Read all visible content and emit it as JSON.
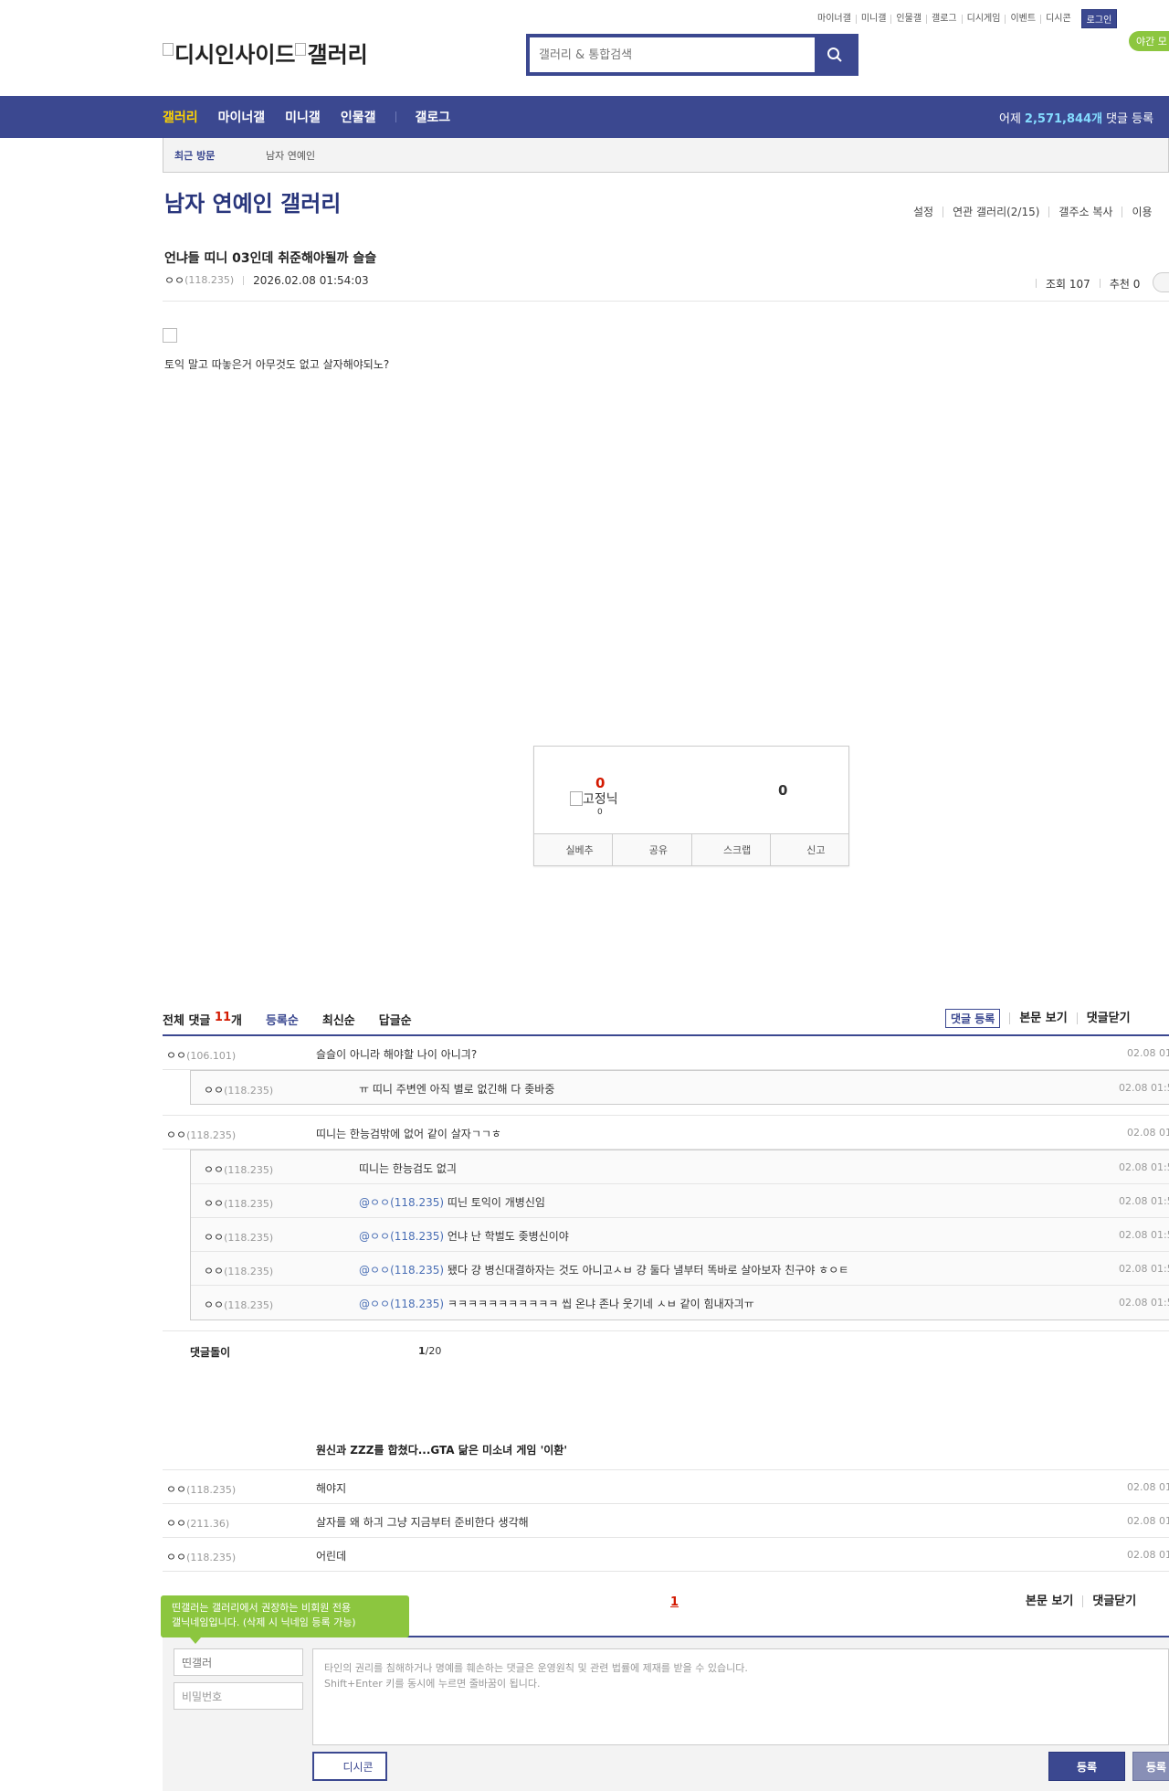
{
  "topmenu": [
    "마이너갤",
    "미니갤",
    "인물갤",
    "갤로그",
    "디시게임",
    "이벤트",
    "디시콘"
  ],
  "login_label": "로그인",
  "night_label": "야간 모",
  "logo": {
    "part1": "디시인사이드",
    "part2": "갤러리"
  },
  "search": {
    "placeholder": "갤러리 & 통합검색"
  },
  "nav": {
    "items": [
      "갤러리",
      "마이너갤",
      "미니갤",
      "인물갤"
    ],
    "gallog": "갤로그",
    "yesterday_prefix": "어제",
    "yesterday_count": "2,571,844개",
    "yesterday_suffix": "댓글 등록"
  },
  "recent": {
    "label": "최근 방문",
    "gallery": "남자 연예인"
  },
  "gallery": {
    "title": "남자 연예인 갤러리",
    "links": [
      "설정",
      "연관 갤러리(2/15)",
      "갤주소 복사",
      "이용"
    ]
  },
  "post": {
    "title": "언냐들 띠니 03인데 취준해야될까 슬슬",
    "author": "ㅇㅇ",
    "ip": "(118.235)",
    "date": "2026.02.08 01:54:03",
    "views_label": "조회 107",
    "recommend_label": "추천 0",
    "body": "토익 말고 따놓은거 아무것도 없고 살자해야되노?"
  },
  "recommend": {
    "up": "0",
    "fixnick_label": "고정닉",
    "fixnick_count": "0",
    "down": "0",
    "buttons": [
      "실베추",
      "공유",
      "스크랩",
      "신고"
    ]
  },
  "comments_header": {
    "total_label": "전체 댓글",
    "total_count": "11",
    "total_unit": "개",
    "sorts": [
      "등록순",
      "최신순",
      "답글순"
    ],
    "register": "댓글 등록",
    "view_body": "본문 보기",
    "close": "댓글닫기"
  },
  "comments": [
    {
      "nick": "ㅇㅇ",
      "ip": "(106.101)",
      "text": "슬슬이 아니라 해야할 나이 아니긔?",
      "date": "02.08 01"
    },
    {
      "nick": "ㅇㅇ",
      "ip": "(118.235)",
      "text": "띠니는 한능검밖에 없어 같이 살자ㄱㄱㅎ",
      "date": "02.08 01"
    }
  ],
  "replies_1": [
    {
      "nick": "ㅇㅇ",
      "ip": "(118.235)",
      "at": "",
      "text": "ㅠ 띠니 주변엔 아직 별로 없긴해 다 좆바중",
      "date": "02.08 01:5"
    }
  ],
  "replies_2": [
    {
      "nick": "ㅇㅇ",
      "ip": "(118.235)",
      "at": "",
      "text": "띠니는 한능검도 없긔",
      "date": "02.08 01:5"
    },
    {
      "nick": "ㅇㅇ",
      "ip": "(118.235)",
      "at": "@ㅇㅇ(118.235)",
      "text": "띠닌 토익이 개병신임",
      "date": "02.08 01:5"
    },
    {
      "nick": "ㅇㅇ",
      "ip": "(118.235)",
      "at": "@ㅇㅇ(118.235)",
      "text": "언냐 난 학벌도 좆병신이야",
      "date": "02.08 01:5"
    },
    {
      "nick": "ㅇㅇ",
      "ip": "(118.235)",
      "at": "@ㅇㅇ(118.235)",
      "text": "됐다 걍 병신대결하자는 것도 아니고ㅅㅂ 걍 둘다 낼부터 똑바로 살아보자 친구야 ㅎㅇㅌ",
      "date": "02.08 01:5"
    },
    {
      "nick": "ㅇㅇ",
      "ip": "(118.235)",
      "at": "@ㅇㅇ(118.235)",
      "text": "ㅋㅋㅋㅋㅋㅋㅋㅋㅋㅋㅋ 씹 온냐 존나 웃기네 ㅅㅂ 같이 힘내자긔ㅠ",
      "date": "02.08 01:5"
    }
  ],
  "cmt_bottom": {
    "label": "댓글돌이",
    "page_current": "1",
    "page_total": "/20"
  },
  "ad_title": "원신과 ZZZ를 합쳤다...GTA 닮은 미소녀 게임 '이환'",
  "comments_after": [
    {
      "nick": "ㅇㅇ",
      "ip": "(118.235)",
      "text": "해야지",
      "date": "02.08 01"
    },
    {
      "nick": "ㅇㅇ",
      "ip": "(211.36)",
      "text": "살자를 왜 하긔 그냥 지금부터 준비한다 생각해",
      "date": "02.08 01"
    },
    {
      "nick": "ㅇㅇ",
      "ip": "(118.235)",
      "text": "어린데",
      "date": "02.08 01"
    }
  ],
  "pagination": {
    "current": "1"
  },
  "bottom_links": {
    "view_body": "본문 보기",
    "close": "댓글닫기"
  },
  "tooltip": {
    "line1": "띤갤러는 갤러리에서 권장하는 비회원 전용",
    "line2": "갤닉네임입니다. (삭제 시 닉네임 등록 가능)"
  },
  "write": {
    "nick_value": "띤갤러",
    "password_placeholder": "비밀번호",
    "notice1": "타인의 권리를 침해하거나 명예를 훼손하는 댓글은 운영원칙 및 관련 법률에 제재를 받을 수 있습니다.",
    "notice2": "Shift+Enter 키를 동시에 누르면 줄바꿈이 됩니다.",
    "dccon": "디시콘",
    "submit": "등록",
    "submit2": "등록"
  },
  "colors": {
    "brand": "#3b4890",
    "accent_red": "#d31900",
    "green": "#8cc63f",
    "nav_active": "#ffd401"
  }
}
